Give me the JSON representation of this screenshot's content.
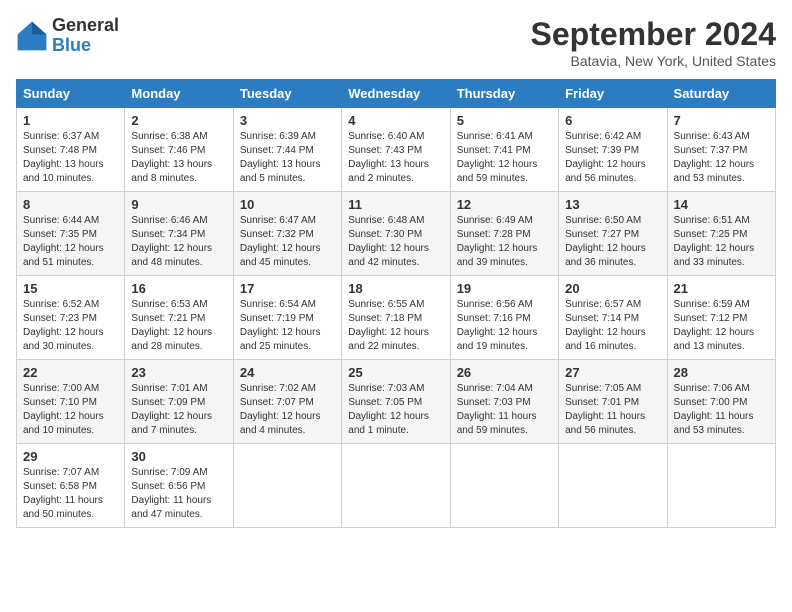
{
  "logo": {
    "general": "General",
    "blue": "Blue"
  },
  "title": "September 2024",
  "location": "Batavia, New York, United States",
  "weekdays": [
    "Sunday",
    "Monday",
    "Tuesday",
    "Wednesday",
    "Thursday",
    "Friday",
    "Saturday"
  ],
  "weeks": [
    [
      {
        "day": "1",
        "sunrise": "6:37 AM",
        "sunset": "7:48 PM",
        "daylight": "13 hours and 10 minutes."
      },
      {
        "day": "2",
        "sunrise": "6:38 AM",
        "sunset": "7:46 PM",
        "daylight": "13 hours and 8 minutes."
      },
      {
        "day": "3",
        "sunrise": "6:39 AM",
        "sunset": "7:44 PM",
        "daylight": "13 hours and 5 minutes."
      },
      {
        "day": "4",
        "sunrise": "6:40 AM",
        "sunset": "7:43 PM",
        "daylight": "13 hours and 2 minutes."
      },
      {
        "day": "5",
        "sunrise": "6:41 AM",
        "sunset": "7:41 PM",
        "daylight": "12 hours and 59 minutes."
      },
      {
        "day": "6",
        "sunrise": "6:42 AM",
        "sunset": "7:39 PM",
        "daylight": "12 hours and 56 minutes."
      },
      {
        "day": "7",
        "sunrise": "6:43 AM",
        "sunset": "7:37 PM",
        "daylight": "12 hours and 53 minutes."
      }
    ],
    [
      {
        "day": "8",
        "sunrise": "6:44 AM",
        "sunset": "7:35 PM",
        "daylight": "12 hours and 51 minutes."
      },
      {
        "day": "9",
        "sunrise": "6:46 AM",
        "sunset": "7:34 PM",
        "daylight": "12 hours and 48 minutes."
      },
      {
        "day": "10",
        "sunrise": "6:47 AM",
        "sunset": "7:32 PM",
        "daylight": "12 hours and 45 minutes."
      },
      {
        "day": "11",
        "sunrise": "6:48 AM",
        "sunset": "7:30 PM",
        "daylight": "12 hours and 42 minutes."
      },
      {
        "day": "12",
        "sunrise": "6:49 AM",
        "sunset": "7:28 PM",
        "daylight": "12 hours and 39 minutes."
      },
      {
        "day": "13",
        "sunrise": "6:50 AM",
        "sunset": "7:27 PM",
        "daylight": "12 hours and 36 minutes."
      },
      {
        "day": "14",
        "sunrise": "6:51 AM",
        "sunset": "7:25 PM",
        "daylight": "12 hours and 33 minutes."
      }
    ],
    [
      {
        "day": "15",
        "sunrise": "6:52 AM",
        "sunset": "7:23 PM",
        "daylight": "12 hours and 30 minutes."
      },
      {
        "day": "16",
        "sunrise": "6:53 AM",
        "sunset": "7:21 PM",
        "daylight": "12 hours and 28 minutes."
      },
      {
        "day": "17",
        "sunrise": "6:54 AM",
        "sunset": "7:19 PM",
        "daylight": "12 hours and 25 minutes."
      },
      {
        "day": "18",
        "sunrise": "6:55 AM",
        "sunset": "7:18 PM",
        "daylight": "12 hours and 22 minutes."
      },
      {
        "day": "19",
        "sunrise": "6:56 AM",
        "sunset": "7:16 PM",
        "daylight": "12 hours and 19 minutes."
      },
      {
        "day": "20",
        "sunrise": "6:57 AM",
        "sunset": "7:14 PM",
        "daylight": "12 hours and 16 minutes."
      },
      {
        "day": "21",
        "sunrise": "6:59 AM",
        "sunset": "7:12 PM",
        "daylight": "12 hours and 13 minutes."
      }
    ],
    [
      {
        "day": "22",
        "sunrise": "7:00 AM",
        "sunset": "7:10 PM",
        "daylight": "12 hours and 10 minutes."
      },
      {
        "day": "23",
        "sunrise": "7:01 AM",
        "sunset": "7:09 PM",
        "daylight": "12 hours and 7 minutes."
      },
      {
        "day": "24",
        "sunrise": "7:02 AM",
        "sunset": "7:07 PM",
        "daylight": "12 hours and 4 minutes."
      },
      {
        "day": "25",
        "sunrise": "7:03 AM",
        "sunset": "7:05 PM",
        "daylight": "12 hours and 1 minute."
      },
      {
        "day": "26",
        "sunrise": "7:04 AM",
        "sunset": "7:03 PM",
        "daylight": "11 hours and 59 minutes."
      },
      {
        "day": "27",
        "sunrise": "7:05 AM",
        "sunset": "7:01 PM",
        "daylight": "11 hours and 56 minutes."
      },
      {
        "day": "28",
        "sunrise": "7:06 AM",
        "sunset": "7:00 PM",
        "daylight": "11 hours and 53 minutes."
      }
    ],
    [
      {
        "day": "29",
        "sunrise": "7:07 AM",
        "sunset": "6:58 PM",
        "daylight": "11 hours and 50 minutes."
      },
      {
        "day": "30",
        "sunrise": "7:09 AM",
        "sunset": "6:56 PM",
        "daylight": "11 hours and 47 minutes."
      },
      null,
      null,
      null,
      null,
      null
    ]
  ],
  "labels": {
    "sunrise_prefix": "Sunrise: ",
    "sunset_prefix": "Sunset: ",
    "daylight_prefix": "Daylight: "
  }
}
